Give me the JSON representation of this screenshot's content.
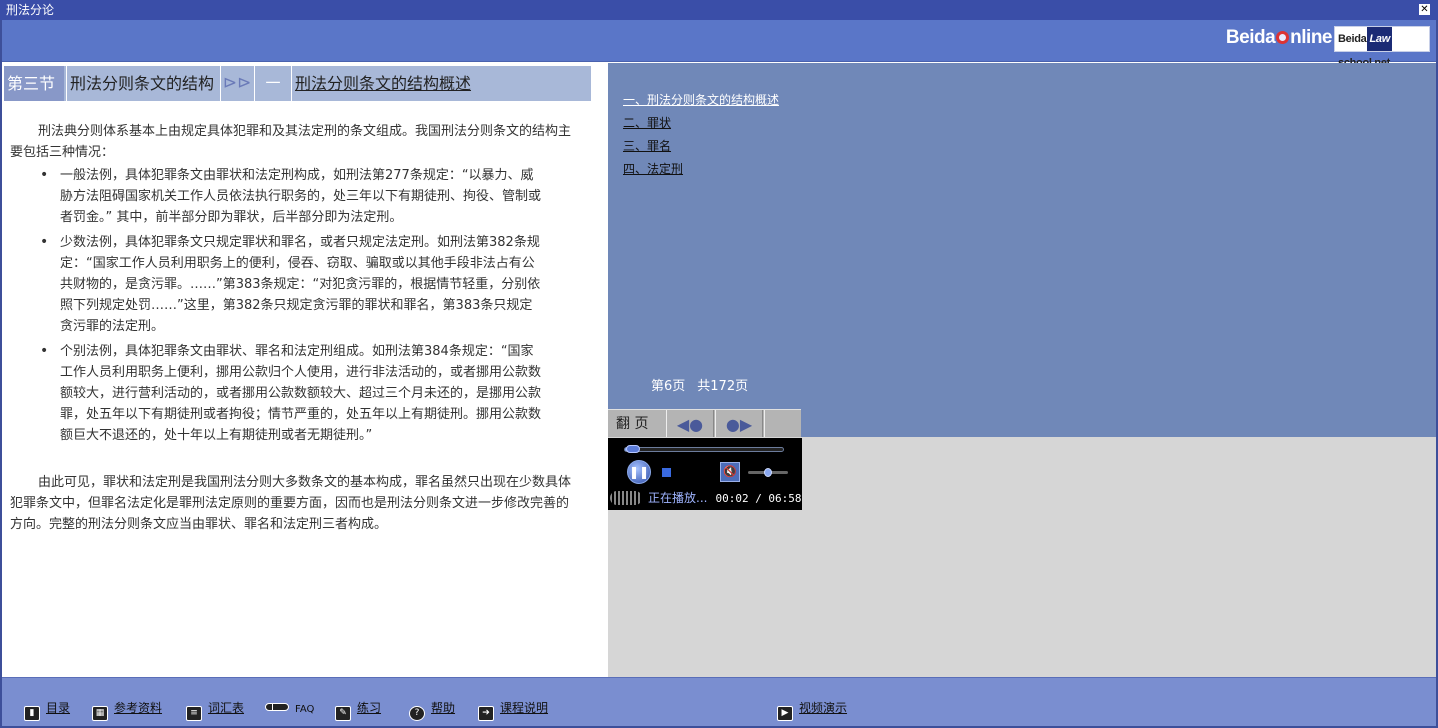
{
  "window": {
    "title": "刑法分论",
    "close_glyph": "✕"
  },
  "header": {
    "brand_left": "Beida",
    "brand_right": "nline",
    "law_logo_left": "Beida",
    "law_logo_law": "Law",
    "law_logo_right": "school.net"
  },
  "nav": {
    "section": "第三节",
    "chapter": "刑法分则条文的结构",
    "arrows": "⊳⊳",
    "number": "一",
    "topic": "刑法分则条文的结构概述"
  },
  "article": {
    "intro": "刑法典分则体系基本上由规定具体犯罪和及其法定刑的条文组成。我国刑法分则条文的结构主要包括三种情况：",
    "bullets": [
      "一般法例，具体犯罪条文由罪状和法定刑构成，如刑法第277条规定：“以暴力、威胁方法阻碍国家机关工作人员依法执行职务的，处三年以下有期徒刑、拘役、管制或者罚金。” 其中，前半部分即为罪状，后半部分即为法定刑。",
      "少数法例，具体犯罪条文只规定罪状和罪名，或者只规定法定刑。如刑法第382条规定：“国家工作人员利用职务上的便利，侵吞、窃取、骗取或以其他手段非法占有公共财物的，是贪污罪。……”第383条规定：“对犯贪污罪的，根据情节轻重，分别依照下列规定处罚……”这里，第382条只规定贪污罪的罪状和罪名，第383条只规定贪污罪的法定刑。",
      "个别法例，具体犯罪条文由罪状、罪名和法定刑组成。如刑法第384条规定：“国家工作人员利用职务上便利，挪用公款归个人使用，进行非法活动的，或者挪用公款数额较大，进行营利活动的，或者挪用公款数额较大、超过三个月未还的，是挪用公款罪，处五年以下有期徒刑或者拘役；情节严重的，处五年以上有期徒刑。挪用公款数额巨大不退还的，处十年以上有期徒刑或者无期徒刑。”"
    ],
    "bullet_glyph": "•",
    "closing": "由此可见，罪状和法定刑是我国刑法分则大多数条文的基本构成，罪名虽然只出现在少数具体犯罪条文中，但罪名法定化是罪刑法定原则的重要方面，因而也是刑法分则条文进一步修改完善的方向。完整的刑法分则条文应当由罪状、罪名和法定刑三者构成。"
  },
  "toc": {
    "items": [
      "一、刑法分则条文的结构概述",
      "二、罪状",
      "三、罪名",
      "四、法定刑"
    ]
  },
  "pager": {
    "current": "第6页",
    "total": "共172页",
    "flip_label": "翻 页",
    "prev_glyph": "◀●",
    "next_glyph": "●▶"
  },
  "player": {
    "status": "正在播放...",
    "time": "00:02 / 06:58",
    "progress": 0.005,
    "volume": 0.5,
    "pause_glyph": "❚❚",
    "mute_glyph": "🔇"
  },
  "footer": {
    "items": [
      {
        "label": "目录",
        "icon": "book-icon",
        "glyph": "▮"
      },
      {
        "label": "参考资料",
        "icon": "library-icon",
        "glyph": "▦"
      },
      {
        "label": "词汇表",
        "icon": "list-icon",
        "glyph": "≡"
      },
      {
        "label": "FAQ",
        "icon": "key-icon",
        "glyph": ""
      },
      {
        "label": "练习",
        "icon": "exercise-icon",
        "glyph": "✎"
      },
      {
        "label": "帮助",
        "icon": "help-icon",
        "glyph": "?"
      },
      {
        "label": "课程说明",
        "icon": "arrow-right-icon",
        "glyph": "➔"
      }
    ],
    "video": {
      "label": "视频演示",
      "icon": "video-icon",
      "glyph": "▶"
    }
  }
}
